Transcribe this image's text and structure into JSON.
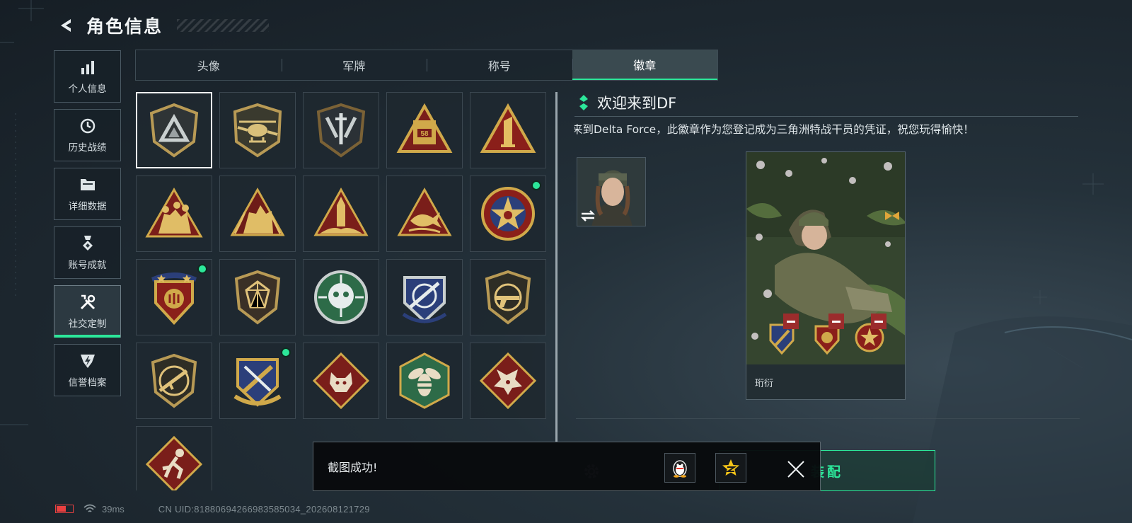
{
  "header": {
    "title": "角色信息"
  },
  "side_nav": [
    {
      "label": "个人信息",
      "icon": "bar-chart-icon",
      "active": false
    },
    {
      "label": "历史战绩",
      "icon": "clock-icon",
      "active": false
    },
    {
      "label": "详细数据",
      "icon": "folder-icon",
      "active": false
    },
    {
      "label": "账号成就",
      "icon": "medal-icon",
      "active": false
    },
    {
      "label": "社交定制",
      "icon": "tools-icon",
      "active": true
    },
    {
      "label": "信誉档案",
      "icon": "shield-bolt-icon",
      "active": false
    }
  ],
  "tabs": [
    {
      "label": "头像",
      "active": false
    },
    {
      "label": "军牌",
      "active": false
    },
    {
      "label": "称号",
      "active": false
    },
    {
      "label": "徽章",
      "active": true
    }
  ],
  "badges": [
    {
      "name": "delta-shield-badge",
      "selected": true,
      "new": false
    },
    {
      "name": "helicopter-badge",
      "selected": false,
      "new": false
    },
    {
      "name": "dagger-shield-badge",
      "selected": false,
      "new": false
    },
    {
      "name": "s8-truck-badge",
      "selected": false,
      "new": false
    },
    {
      "name": "number-one-badge",
      "selected": false,
      "new": false
    },
    {
      "name": "soldiers-triangle-badge",
      "selected": false,
      "new": false
    },
    {
      "name": "squad-wreath-badge",
      "selected": false,
      "new": false
    },
    {
      "name": "missile-triangle-badge",
      "selected": false,
      "new": false
    },
    {
      "name": "fish-triangle-badge",
      "selected": false,
      "new": false
    },
    {
      "name": "star-seal-badge",
      "selected": false,
      "new": true
    },
    {
      "name": "crest-stars-badge",
      "selected": false,
      "new": true
    },
    {
      "name": "gem-shield-badge",
      "selected": false,
      "new": false
    },
    {
      "name": "skull-crosshair-badge",
      "selected": false,
      "new": false
    },
    {
      "name": "rifle-crosshair-badge",
      "selected": false,
      "new": false
    },
    {
      "name": "pistol-shield-badge",
      "selected": false,
      "new": false
    },
    {
      "name": "rifle-circle-badge",
      "selected": false,
      "new": false
    },
    {
      "name": "pen-rifle-badge",
      "selected": false,
      "new": true
    },
    {
      "name": "wolf-diamond-badge",
      "selected": false,
      "new": false
    },
    {
      "name": "bee-hexagon-badge",
      "selected": false,
      "new": false
    },
    {
      "name": "dragon-diamond-badge",
      "selected": false,
      "new": false
    },
    {
      "name": "runner-diamond-badge",
      "selected": false,
      "new": false
    }
  ],
  "detail": {
    "title": "欢迎来到DF",
    "description": "来到Delta Force，此徽章作为您登记成为三角洲特战干员的凭证，祝您玩得愉快！",
    "card_name": "珩衍"
  },
  "equip_label": "装配",
  "toast": {
    "text": "截图成功!"
  },
  "status": {
    "ping": "39ms",
    "uid": "CN UID:8188069426698358503​4_202608121729"
  },
  "colors": {
    "accent": "#2ce79a",
    "gold": "#c9a24a",
    "remove": "#9b2c2c"
  }
}
